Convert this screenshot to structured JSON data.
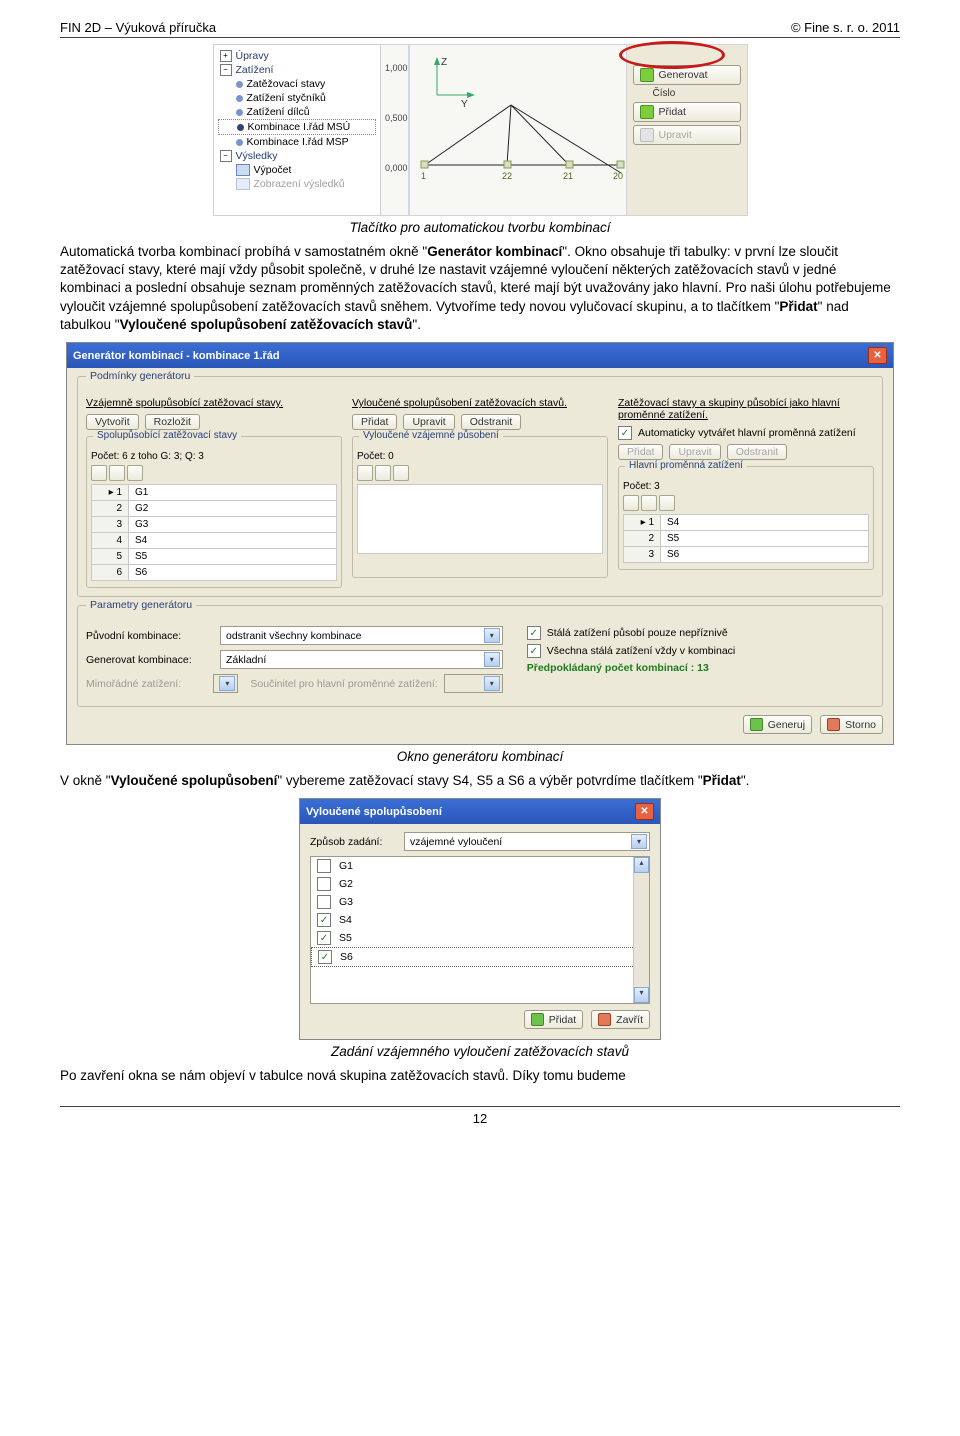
{
  "header": {
    "left": "FIN 2D – Výuková příručka",
    "right": "© Fine s. r. o. 2011"
  },
  "fig1": {
    "tree": {
      "groups": [
        "Úpravy",
        "Zatížení",
        "Výsledky"
      ],
      "load_items": [
        "Zatěžovací stavy",
        "Zatížení styčníků",
        "Zatížení dílců",
        "Kombinace I.řád MSÚ",
        "Kombinace I.řád MSP"
      ],
      "result_items": [
        "Výpočet",
        "Zobrazení výsledků"
      ]
    },
    "axis": {
      "ticks": [
        "1,000",
        "0,500",
        "0,000"
      ],
      "y": "Y",
      "z": "Z",
      "marks": [
        "1",
        "22",
        "21",
        "20"
      ]
    },
    "buttons": [
      "Generovat",
      "Přidat",
      "Upravit"
    ],
    "side_label": "Číslo"
  },
  "caption1": "Tlačítko pro automatickou tvorbu kombinací",
  "para1_a": "Automatická tvorba kombinací probíhá v samostatném okně \"",
  "para1_b": "Generátor kombinací",
  "para1_c": "\". Okno obsahuje tři tabulky: v první lze sloučit zatěžovací stavy, které mají vždy působit společně, v druhé lze nastavit vzájemné vyloučení některých zatěžovacích stavů v jedné kombinaci a poslední obsahuje seznam proměnných zatěžovacích stavů, které mají být uvažovány jako hlavní. Pro naši úlohu potřebujeme vyloučit vzájemné spolupůsobení zatěžovacích stavů sněhem. Vytvoříme tedy novou vylučovací skupinu, a to tlačítkem \"",
  "para1_d": "Přidat",
  "para1_e": "\" nad tabulkou \"",
  "para1_f": "Vyloučené spolupůsobení zatěžovacích stavů",
  "para1_g": "\".",
  "fig2": {
    "title": "Generátor kombinací - kombinace 1.řád",
    "group1": "Podmínky generátoru",
    "col1": {
      "head": "Vzájemně spolupůsobící zatěžovací stavy.",
      "btns": [
        "Vytvořit",
        "Rozložit"
      ],
      "box_label": "Spolupůsobící zatěžovací stavy",
      "meta": "Počet: 6  z toho  G: 3;  Q: 3",
      "rows": [
        "G1",
        "G2",
        "G3",
        "S4",
        "S5",
        "S6"
      ]
    },
    "col2": {
      "head": "Vyloučené spolupůsobení zatěžovacích stavů.",
      "btns": [
        "Přidat",
        "Upravit",
        "Odstranit"
      ],
      "box_label": "Vyloučené vzájemné působení",
      "meta": "Počet: 0"
    },
    "col3": {
      "head": "Zatěžovací stavy a skupiny působící jako hlavní proměnné zatížení.",
      "auto": "Automaticky vytvářet hlavní proměnná zatížení",
      "btns": [
        "Přidat",
        "Upravit",
        "Odstranit"
      ],
      "box_label": "Hlavní proměnná zatížení",
      "meta": "Počet: 3",
      "rows": [
        "S4",
        "S5",
        "S6"
      ]
    },
    "group2": "Parametry generátoru",
    "params": {
      "l1": "Původní kombinace:",
      "v1": "odstranit všechny kombinace",
      "l2": "Generovat kombinace:",
      "v2": "Základní",
      "l3": "Mimořádné zatížení:",
      "mid": "Součinitel pro hlavní proměnné zatížení:",
      "c1": "Stálá zatížení působí pouze nepříznivě",
      "c2": "Všechna stálá zatížení vždy v kombinaci",
      "pred": "Předpokládaný počet kombinací : 13"
    },
    "footer": [
      "Generuj",
      "Storno"
    ]
  },
  "caption2": "Okno generátoru kombinací",
  "para2_a": "V okně \"",
  "para2_b": "Vyloučené spolupůsobení",
  "para2_c": "\" vybereme zatěžovací stavy S4, S5 a S6 a výběr potvrdíme tlačítkem \"",
  "para2_d": "Přidat",
  "para2_e": "\".",
  "fig3": {
    "title": "Vyloučené spolupůsobení",
    "mode_label": "Způsob zadání:",
    "mode_value": "vzájemné vyloučení",
    "rows": [
      "G1",
      "G2",
      "G3",
      "S4",
      "S5",
      "S6"
    ],
    "checked": [
      false,
      false,
      false,
      true,
      true,
      true
    ],
    "footer": [
      "Přidat",
      "Zavřít"
    ]
  },
  "caption3": "Zadání vzájemného vyloučení zatěžovacích stavů",
  "para3": "Po zavření okna se nám objeví v tabulce nová skupina zatěžovacích stavů. Díky tomu budeme",
  "pagenum": "12"
}
